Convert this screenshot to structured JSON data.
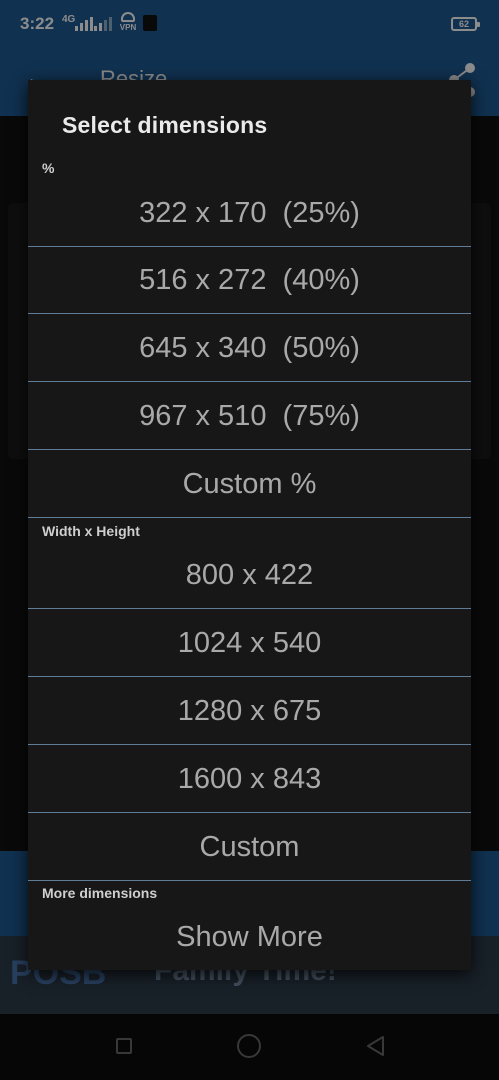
{
  "status_bar": {
    "time": "3:22",
    "network": "4G",
    "vpn_label": "VPN",
    "battery": "62"
  },
  "app_bar": {
    "title": "Resize"
  },
  "ad": {
    "brand": "POSB",
    "tagline": "Family Time!"
  },
  "dialog": {
    "title": "Select dimensions",
    "sections": [
      {
        "header": "%",
        "options": [
          "322 x 170  (25%)",
          "516 x 272  (40%)",
          "645 x 340  (50%)",
          "967 x 510  (75%)",
          "Custom %"
        ]
      },
      {
        "header": "Width x Height",
        "options": [
          "800 x 422",
          "1024 x 540",
          "1280 x 675",
          "1600 x 843",
          "Custom"
        ]
      },
      {
        "header": "More dimensions",
        "options": [
          "Show More"
        ]
      }
    ]
  },
  "colors": {
    "primary": "#1e5a92",
    "dialog_bg": "#171717",
    "divider": "#5f7d98"
  }
}
